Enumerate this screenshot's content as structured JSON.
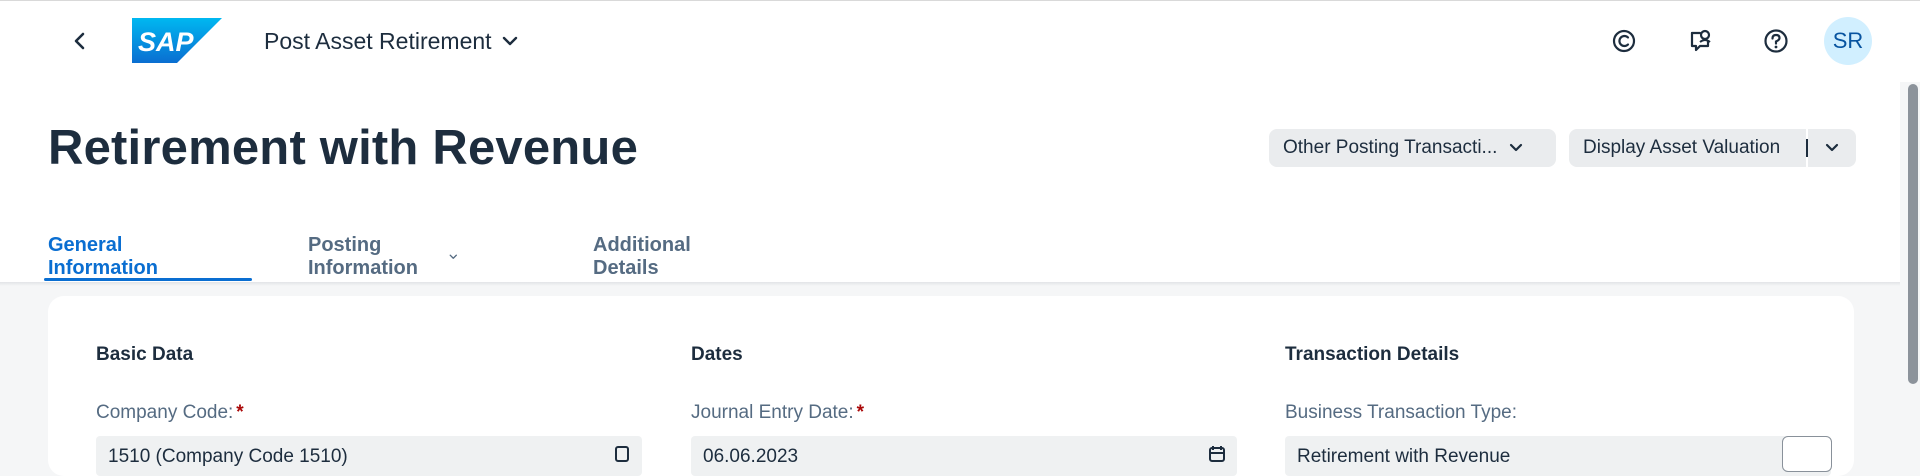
{
  "shell": {
    "app_title": "Post Asset Retirement",
    "logo_text": "SAP",
    "avatar_initials": "SR",
    "icons": [
      "back-icon",
      "co-pilot-icon",
      "feedback-icon",
      "help-icon"
    ]
  },
  "header": {
    "title": "Retirement with Revenue",
    "actions": {
      "other_posting": "Other Posting Transacti...",
      "display_valuation": "Display Asset Valuation"
    },
    "tabs": [
      {
        "label": "General Information",
        "active": true
      },
      {
        "label": "Posting Information",
        "has_dropdown": true
      },
      {
        "label": "Additional Details"
      }
    ]
  },
  "content": {
    "sections": [
      {
        "title": "Basic Data",
        "field_label": "Company Code:",
        "required": "*",
        "value": "1510 (Company Code 1510)"
      },
      {
        "title": "Dates",
        "field_label": "Journal Entry Date:",
        "required": "*",
        "value": "06.06.2023"
      },
      {
        "title": "Transaction Details",
        "field_label": "Business Transaction Type:",
        "value": "Retirement with Revenue"
      }
    ]
  },
  "colors": {
    "brand_blue": "#0a6ed1",
    "text_dark": "#1d2d3e",
    "required": "#aa0808",
    "avatar_bg": "#d1efff"
  }
}
